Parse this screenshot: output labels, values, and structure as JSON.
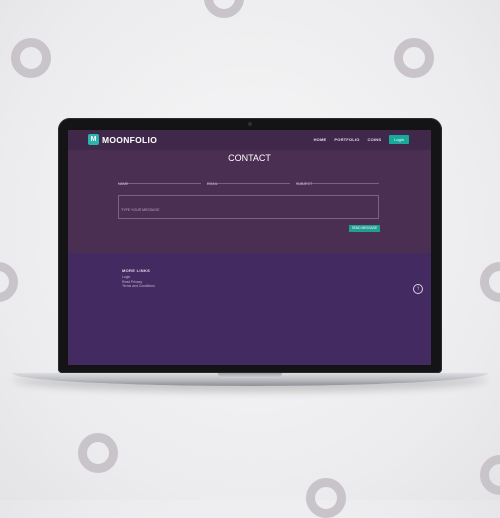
{
  "brand": {
    "name": "MOONFOLIO",
    "logo_mark": "M",
    "accent": "#19a99b"
  },
  "nav": {
    "links": [
      "HOME",
      "PORTFOLIO",
      "COINS"
    ],
    "login_label": "Login"
  },
  "contact": {
    "title": "CONTACT",
    "name_label": "NAME",
    "email_label": "EMAIL",
    "subject_label": "SUBJECT",
    "message_placeholder": "TYPE YOUR MESSAGE",
    "send_label": "SEND MESSAGE"
  },
  "footer": {
    "title": "MORE LINKS",
    "links": [
      "Login",
      "Read Privacy",
      "Terms and Conditions"
    ],
    "up_icon": "arrow-up-icon"
  },
  "colors": {
    "contact_bg": "#4a2f52",
    "footer_bg": "#432b62",
    "ring": "#c9c3ca"
  }
}
